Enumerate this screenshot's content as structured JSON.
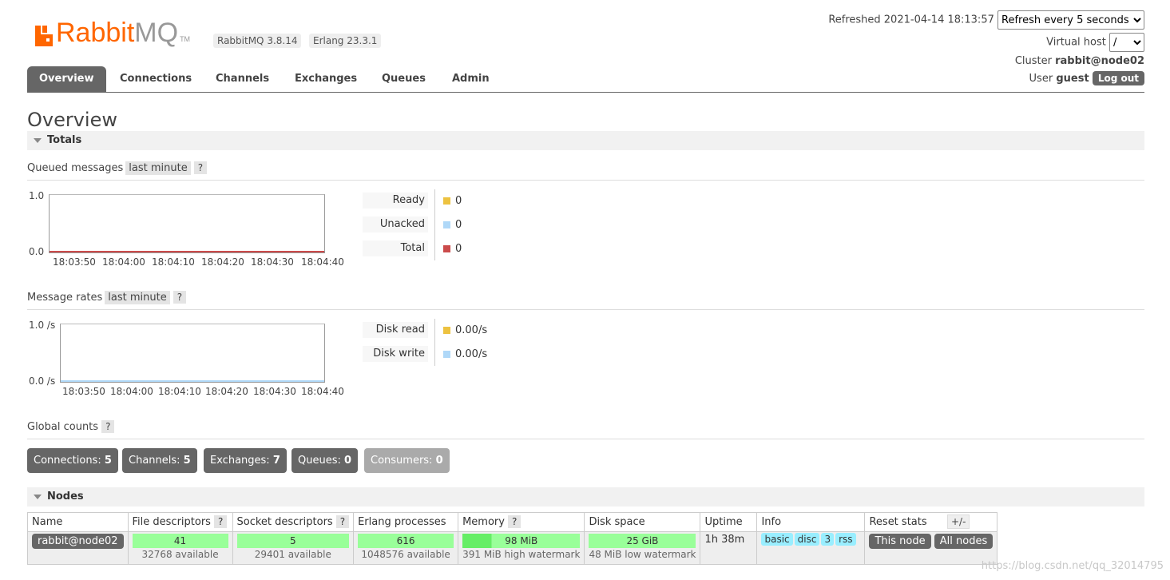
{
  "header": {
    "brand_main": "Rabbit",
    "brand_mq": "MQ",
    "brand_tm": "TM",
    "version_rabbit": "RabbitMQ 3.8.14",
    "version_erlang": "Erlang 23.3.1",
    "refreshed_label": "Refreshed 2021-04-14 18:13:57",
    "refresh_select": "Refresh every 5 seconds",
    "vhost_label": "Virtual host",
    "vhost_value": "/",
    "cluster_label": "Cluster",
    "cluster_value": "rabbit@node02",
    "user_label": "User",
    "user_value": "guest",
    "logout_label": "Log out"
  },
  "tabs": [
    {
      "label": "Overview",
      "active": true
    },
    {
      "label": "Connections"
    },
    {
      "label": "Channels"
    },
    {
      "label": "Exchanges"
    },
    {
      "label": "Queues"
    },
    {
      "label": "Admin"
    }
  ],
  "page_title": "Overview",
  "totals": {
    "section_label": "Totals",
    "queued": {
      "title": "Queued messages",
      "range": "last minute",
      "help": "?",
      "y_top": "1.0",
      "y_bottom": "0.0",
      "x_ticks": [
        "18:03:50",
        "18:04:00",
        "18:04:10",
        "18:04:20",
        "18:04:30",
        "18:04:40"
      ],
      "legend": [
        {
          "label": "Ready",
          "value": "0",
          "color": "#edc240"
        },
        {
          "label": "Unacked",
          "value": "0",
          "color": "#afd8f8"
        },
        {
          "label": "Total",
          "value": "0",
          "color": "#cb4b4b"
        }
      ]
    },
    "rates": {
      "title": "Message rates",
      "range": "last minute",
      "help": "?",
      "y_top": "1.0 /s",
      "y_bottom": "0.0 /s",
      "x_ticks": [
        "18:03:50",
        "18:04:00",
        "18:04:10",
        "18:04:20",
        "18:04:30",
        "18:04:40"
      ],
      "legend": [
        {
          "label": "Disk read",
          "value": "0.00/s",
          "color": "#edc240"
        },
        {
          "label": "Disk write",
          "value": "0.00/s",
          "color": "#afd8f8"
        }
      ]
    },
    "global": {
      "title": "Global counts",
      "help": "?",
      "items": [
        {
          "label": "Connections:",
          "value": "5"
        },
        {
          "label": "Channels:",
          "value": "5"
        },
        {
          "label": "Exchanges:",
          "value": "7"
        },
        {
          "label": "Queues:",
          "value": "0"
        },
        {
          "label": "Consumers:",
          "value": "0"
        }
      ]
    }
  },
  "nodes": {
    "section_label": "Nodes",
    "columns": {
      "name": "Name",
      "fd": "File descriptors",
      "sd": "Socket descriptors",
      "ep": "Erlang processes",
      "mem": "Memory",
      "disk": "Disk space",
      "uptime": "Uptime",
      "info": "Info",
      "reset": "Reset stats",
      "help": "?",
      "plusminus": "+/-"
    },
    "row": {
      "name": "rabbit@node02",
      "fd": "41",
      "fd_avail": "32768 available",
      "sd": "5",
      "sd_avail": "29401 available",
      "ep": "616",
      "ep_avail": "1048576 available",
      "mem": "98 MiB",
      "mem_sub": "391 MiB high watermark",
      "disk": "25 GiB",
      "disk_sub": "48 MiB low watermark",
      "uptime": "1h 38m",
      "info_tags": [
        "basic",
        "disc",
        "3",
        "rss"
      ],
      "reset_this": "This node",
      "reset_all": "All nodes"
    }
  },
  "watermark": "https://blog.csdn.net/qq_32014795"
}
